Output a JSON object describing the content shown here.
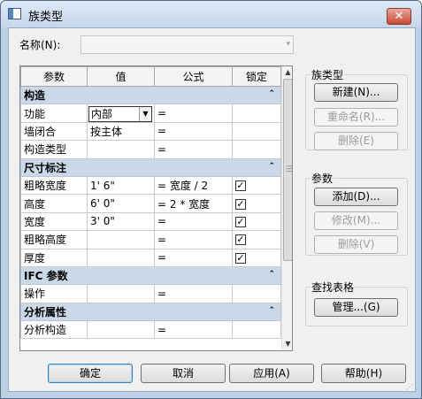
{
  "window": {
    "title": "族类型",
    "close_glyph": "✕",
    "title_icon": "window-icon"
  },
  "name_field": {
    "label": "名称(N):",
    "value": "",
    "arrow": "▾"
  },
  "grid": {
    "headers": [
      "参数",
      "值",
      "公式",
      "锁定"
    ],
    "sections": [
      {
        "title": "构造",
        "rows": [
          {
            "param": "功能",
            "value": "内部",
            "formula": "=",
            "locked": null,
            "combo": true
          },
          {
            "param": "墙闭合",
            "value": "按主体",
            "formula": "=",
            "locked": null
          },
          {
            "param": "构造类型",
            "value": "",
            "formula": "=",
            "locked": null
          }
        ]
      },
      {
        "title": "尺寸标注",
        "rows": [
          {
            "param": "粗略宽度",
            "value": "1'  6\"",
            "formula": "= 宽度 / 2",
            "locked": true
          },
          {
            "param": "高度",
            "value": "6'  0\"",
            "formula": "= 2 * 宽度",
            "locked": true
          },
          {
            "param": "宽度",
            "value": "3'  0\"",
            "formula": "=",
            "locked": true
          },
          {
            "param": "粗略高度",
            "value": "",
            "formula": "=",
            "locked": true
          },
          {
            "param": "厚度",
            "value": "",
            "formula": "=",
            "locked": true
          }
        ]
      },
      {
        "title": "IFC 参数",
        "rows": [
          {
            "param": "操作",
            "value": "",
            "formula": "=",
            "locked": null
          }
        ]
      },
      {
        "title": "分析属性",
        "rows": [
          {
            "param": "分析构造",
            "value": "",
            "formula": "=",
            "locked": null
          }
        ]
      }
    ],
    "collapse_glyph": "⌃",
    "check_glyph": "✓",
    "scroll_up": "▲",
    "scroll_down": "▼"
  },
  "family_types": {
    "label": "族类型",
    "new": "新建(N)...",
    "rename": "重命名(R)...",
    "delete": "删除(E)"
  },
  "parameters": {
    "label": "参数",
    "add": "添加(D)...",
    "modify": "修改(M)...",
    "remove": "删除(V)"
  },
  "lookup": {
    "label": "查找表格",
    "manage": "管理...(G)"
  },
  "buttons": {
    "ok": "确定",
    "cancel": "取消",
    "apply": "应用(A)",
    "help": "帮助(H)"
  },
  "colors": {
    "section_bg": "#cad8e8",
    "titlebar": "#c5d6ea",
    "close": "#c84a34"
  }
}
